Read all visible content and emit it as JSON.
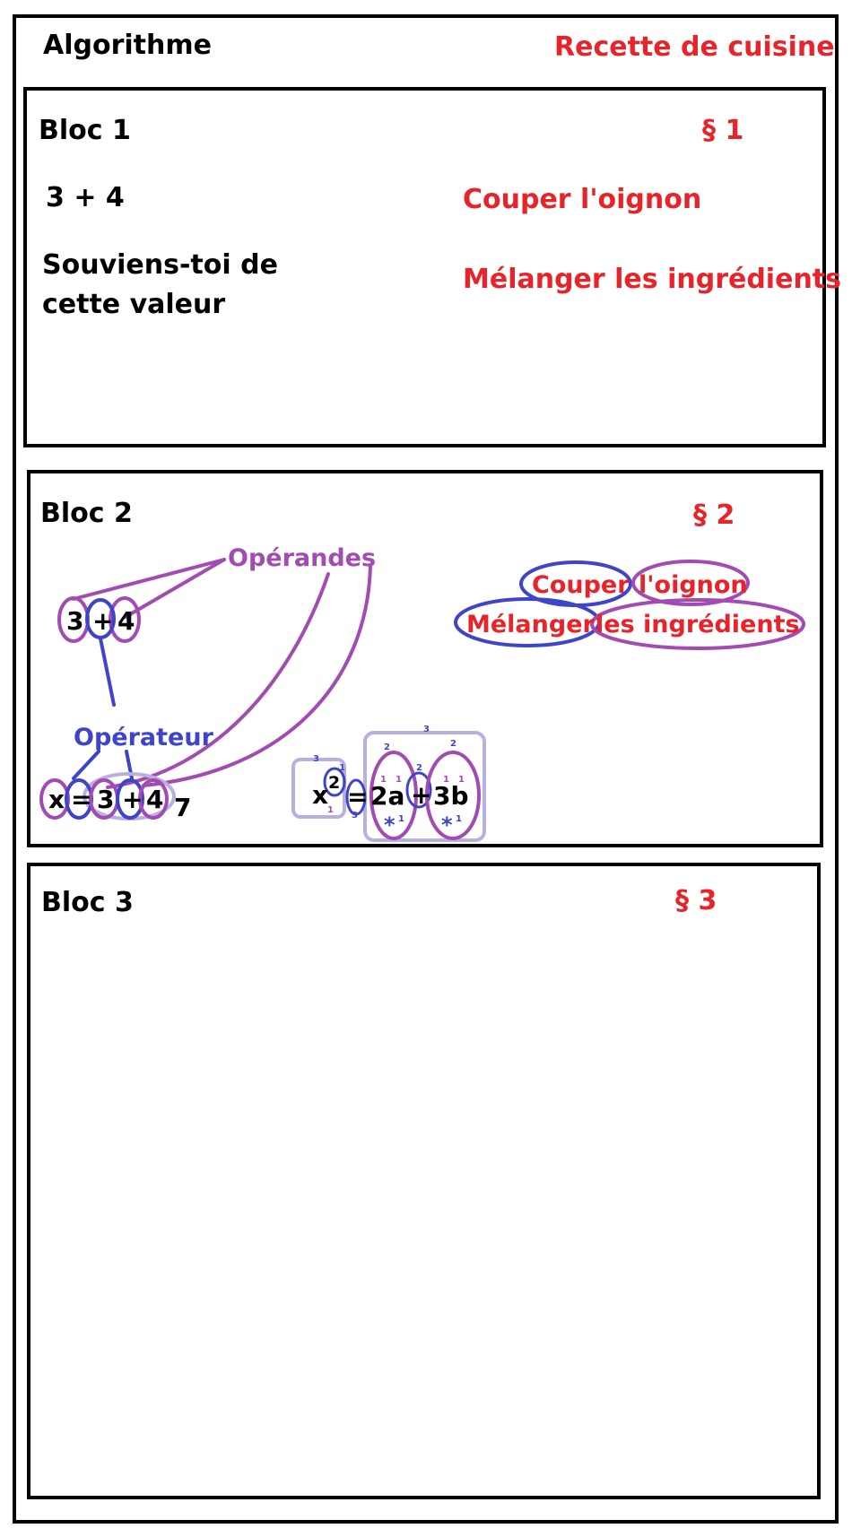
{
  "header": {
    "left_title": "Algorithme",
    "right_title": "Recette de cuisine"
  },
  "bloc1": {
    "title": "Bloc 1",
    "paragraph": "§ 1",
    "expr": "3 + 4",
    "instruction": "Souviens-toi de cette valeur",
    "recipe_step1": "Couper l'oignon",
    "recipe_step2": "Mélanger les ingrédients"
  },
  "bloc2": {
    "title": "Bloc 2",
    "paragraph": "§ 2",
    "operands_label": "Opérandes",
    "operator_label": "Opérateur",
    "expr_operand1": "3",
    "expr_operator": "+",
    "expr_operand2": "4",
    "assign_var": "x",
    "assign_eq": "=",
    "assign_operand1": "3",
    "assign_operator": "+",
    "assign_operand2": "4",
    "assign_result": "7",
    "eq_var": "x",
    "eq_exp": "2",
    "eq_eq": "=",
    "eq_term1": "2a",
    "eq_plus": "+",
    "eq_term2": "3b",
    "eq_star": "*",
    "eq_marks": {
      "one": "1",
      "two": "2",
      "three": "3"
    },
    "recipe_verb1": "Couper",
    "recipe_obj1": "l'oignon",
    "recipe_verb2": "Mélanger",
    "recipe_obj2": "les ingrédients"
  },
  "bloc3": {
    "title": "Bloc 3",
    "paragraph": "§ 3"
  },
  "colors": {
    "operand_purple": "#a24bb2",
    "operator_blue": "#3e45c9",
    "group_lavender": "#b8b0e0",
    "recipe_red": "#e8242b"
  }
}
